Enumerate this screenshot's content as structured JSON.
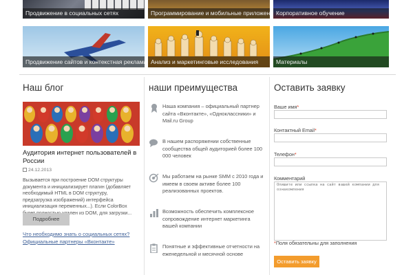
{
  "tiles_top": [
    {
      "caption": "Продвижение в социальных сетях"
    },
    {
      "caption": "Программирование и мобильные приложения"
    },
    {
      "caption": "Корпоративное обучение"
    }
  ],
  "tiles_mid": [
    {
      "caption": "Продвижение сайтов и контекстная реклама"
    },
    {
      "caption": "Анализ и маркетинговые исследования"
    },
    {
      "caption": "Материалы"
    }
  ],
  "blog": {
    "title": "Наш блог",
    "post_title": "Аудитория интернет пользователей в России",
    "date": "24.12.2013",
    "excerpt": "Вызывается при построение DOM структуры документа и инициализирует плагин (добавляет необходимый HTML в DOM структуру, предзагрузка изображений) интерфейса инициализация переменных...). Если ColorBox будет полностью удален из DOM, для загрузки...",
    "more_button": "Подробнее",
    "link1": "Что необходимо знать о социальных сетях?",
    "link2": "Официальные партнеры «Вконтакте»"
  },
  "advantages": {
    "title": "наши преимущества",
    "items": [
      {
        "icon": "award-icon",
        "text": "Наша компания – официальный партнер сайта «Вконтакте», «Одноклассники» и Mail.ru Group"
      },
      {
        "icon": "chat-icon",
        "text": "В нашем распоряжении собственные сообщества общей аудиторией более 100 000 человек"
      },
      {
        "icon": "target-icon",
        "text": "Мы работаем на рынке SMM с 2010 года и имеем в своем активе более 100 реализованных проектов."
      },
      {
        "icon": "chart-icon",
        "text": "Возможность обеспечить комплексное сопровождение интернет маркетинга вашей компании"
      },
      {
        "icon": "clipboard-icon",
        "text": "Понятные и эффективные отчетности на еженедельной и месячной основе"
      }
    ]
  },
  "form": {
    "title": "Оставить заявку",
    "name_label": "Ваше имя",
    "email_label": "Контактный Email",
    "phone_label": "Телефон",
    "comment_label": "Комментарий",
    "comment_placeholder": "Опишите или ссылка на сайт вашей компании для ознакомления",
    "required_note": "Поля обязательны для заполнения",
    "submit": "Оставить заявку",
    "asterisk": "*"
  },
  "colors": {
    "accent": "#f39c2d",
    "button_grey": "#c8c8c8",
    "link": "#3d5f97",
    "required": "#d9381e"
  }
}
